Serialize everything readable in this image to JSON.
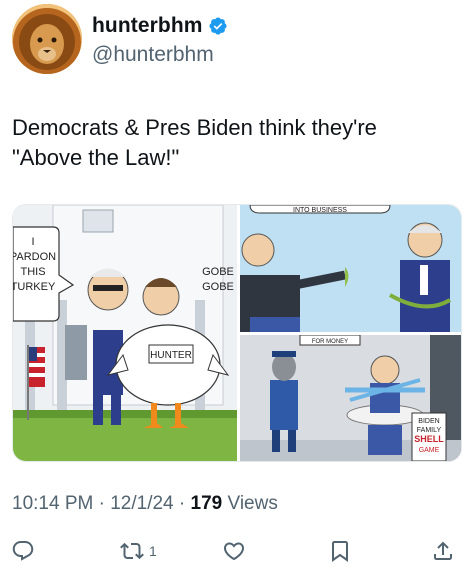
{
  "author": {
    "display_name": "hunterbhm",
    "handle": "@hunterbhm",
    "avatar": "lion-avatar",
    "verified": true
  },
  "tweet": {
    "text_line1": "Democrats & Pres Biden think they're",
    "text_line2": "\"Above the Law!\""
  },
  "media": {
    "left_panel": {
      "speech_bubble": [
        "I",
        "PARDON",
        "THIS",
        "TURKEY"
      ],
      "gobble": [
        "GOBE",
        "GOBE"
      ],
      "turkey_label": "HUNTER"
    },
    "top_right_panel": {
      "banner": "INTO  BUSINESS"
    },
    "bottom_right_panel": {
      "sign": "FOR MONEY",
      "shell_sign": [
        "BIDEN",
        "FAMILY",
        "SHELL",
        "GAME"
      ]
    }
  },
  "meta": {
    "time": "10:14 PM",
    "date": "12/1/24",
    "views_count": "179",
    "views_label": "Views"
  },
  "actions": {
    "reply": {
      "icon": "reply-icon",
      "count": ""
    },
    "retweet": {
      "icon": "retweet-icon",
      "count": "1"
    },
    "like": {
      "icon": "heart-icon",
      "count": ""
    },
    "bookmark": {
      "icon": "bookmark-icon",
      "count": ""
    },
    "share": {
      "icon": "share-icon",
      "count": ""
    }
  },
  "colors": {
    "text": "#0f1419",
    "secondary": "#536471",
    "verified": "#1d9bf0"
  }
}
